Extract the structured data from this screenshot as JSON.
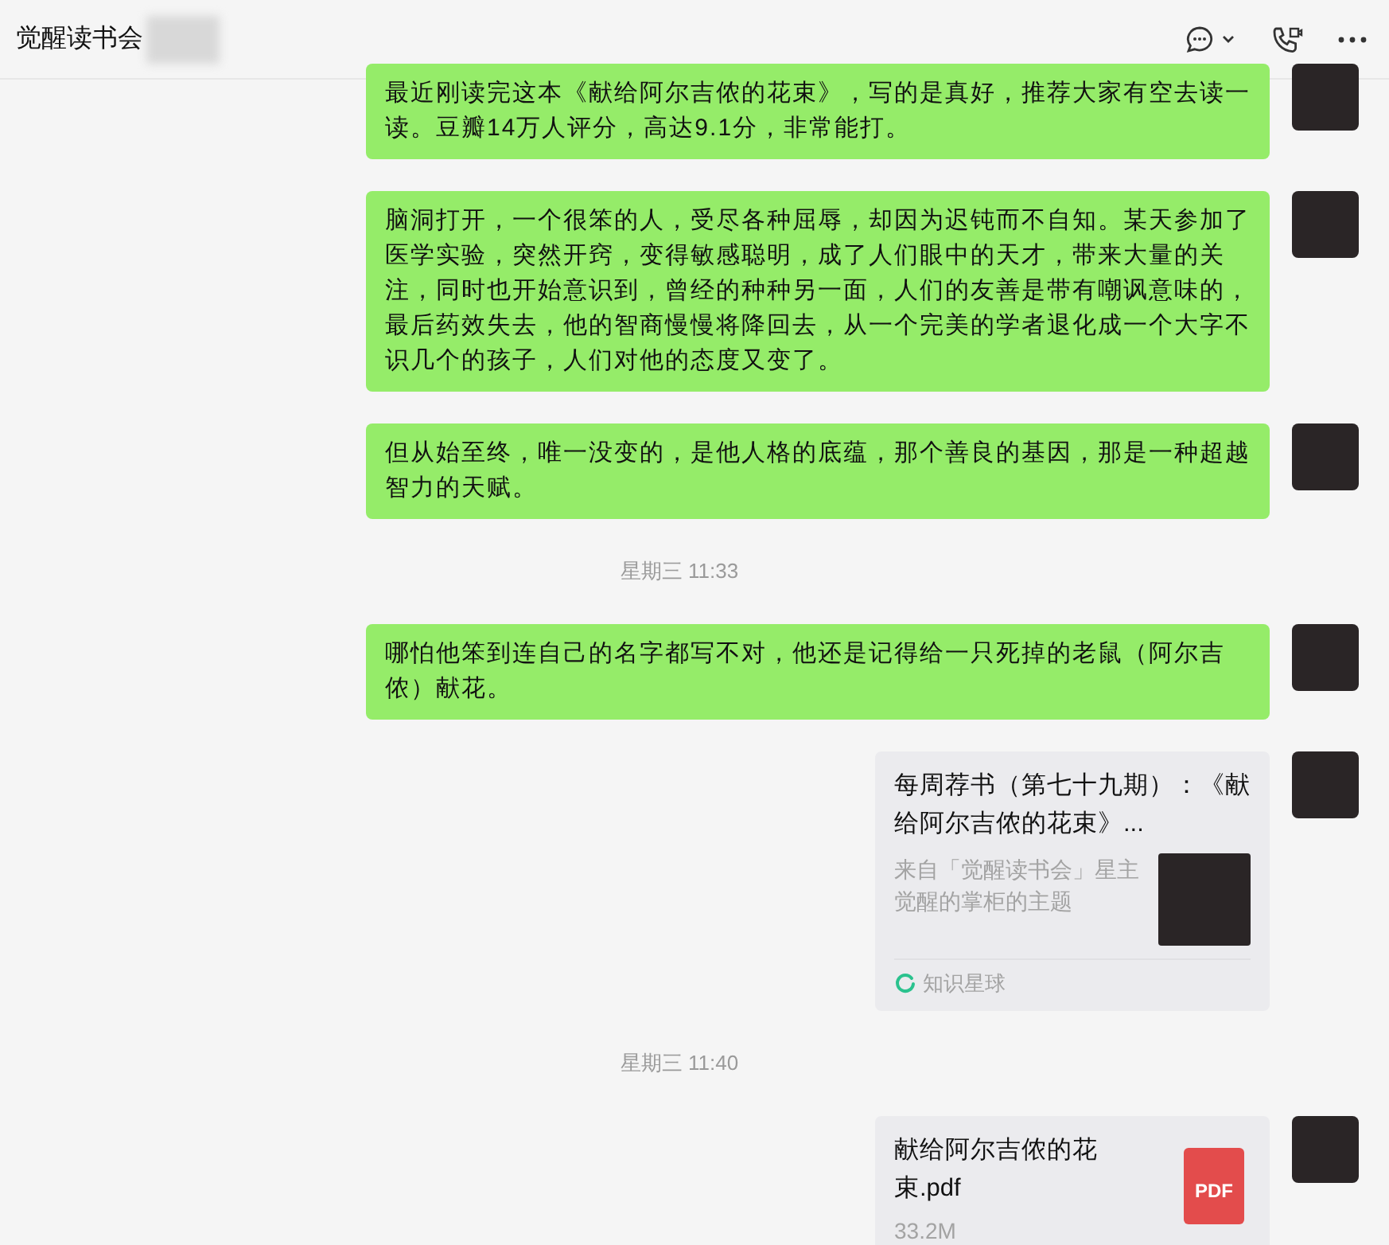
{
  "header": {
    "title": "觉醒读书会"
  },
  "messages": [
    {
      "kind": "text",
      "text": "最近刚读完这本《献给阿尔吉侬的花束》，写的是真好，推荐大家有空去读一读。豆瓣14万人评分，高达9.1分，非常能打。"
    },
    {
      "kind": "text",
      "text": "脑洞打开，一个很笨的人，受尽各种屈辱，却因为迟钝而不自知。某天参加了医学实验，突然开窍，变得敏感聪明，成了人们眼中的天才，带来大量的关注，同时也开始意识到，曾经的种种另一面，人们的友善是带有嘲讽意味的，最后药效失去，他的智商慢慢将降回去，从一个完美的学者退化成一个大字不识几个的孩子，人们对他的态度又变了。"
    },
    {
      "kind": "text",
      "text": "但从始至终，唯一没变的，是他人格的底蕴，那个善良的基因，那是一种超越智力的天赋。"
    },
    {
      "kind": "time",
      "text": "星期三 11:33"
    },
    {
      "kind": "text",
      "text": "哪怕他笨到连自己的名字都写不对，他还是记得给一只死掉的老鼠（阿尔吉侬）献花。"
    },
    {
      "kind": "link",
      "title": "每周荐书（第七十九期）：《献给阿尔吉侬的花束》...",
      "description": "来自「觉醒读书会」星主觉醒的掌柜的主题",
      "source": "知识星球"
    },
    {
      "kind": "time",
      "text": "星期三 11:40"
    },
    {
      "kind": "file",
      "name": "献给阿尔吉侬的花束.pdf",
      "size": "33.2M",
      "icon_label": "PDF"
    }
  ]
}
